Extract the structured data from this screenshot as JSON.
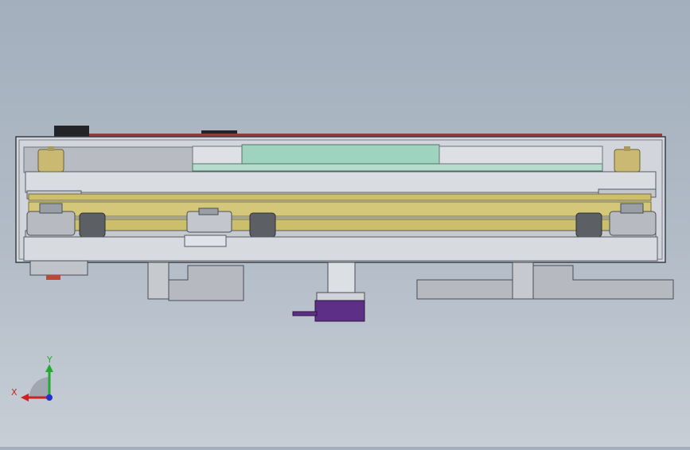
{
  "viewport": {
    "background_top": "#a3afbd",
    "background_bottom": "#c7ced6"
  },
  "colors": {
    "frame": "#d2d6dc",
    "frame_edge": "#3a3f48",
    "rail_gold": "#cbbf6c",
    "panel_green": "#9ed3c0",
    "bushing_gold": "#c9b973",
    "roller_dark": "#5c5f63",
    "purple_sensor": "#5d2f86",
    "red_strip": "#8f3b3b"
  },
  "triad": {
    "x_label": "X",
    "y_label": "Y",
    "x_color": "#cc2222",
    "y_color": "#22aa33",
    "z_color": "#2233cc"
  }
}
